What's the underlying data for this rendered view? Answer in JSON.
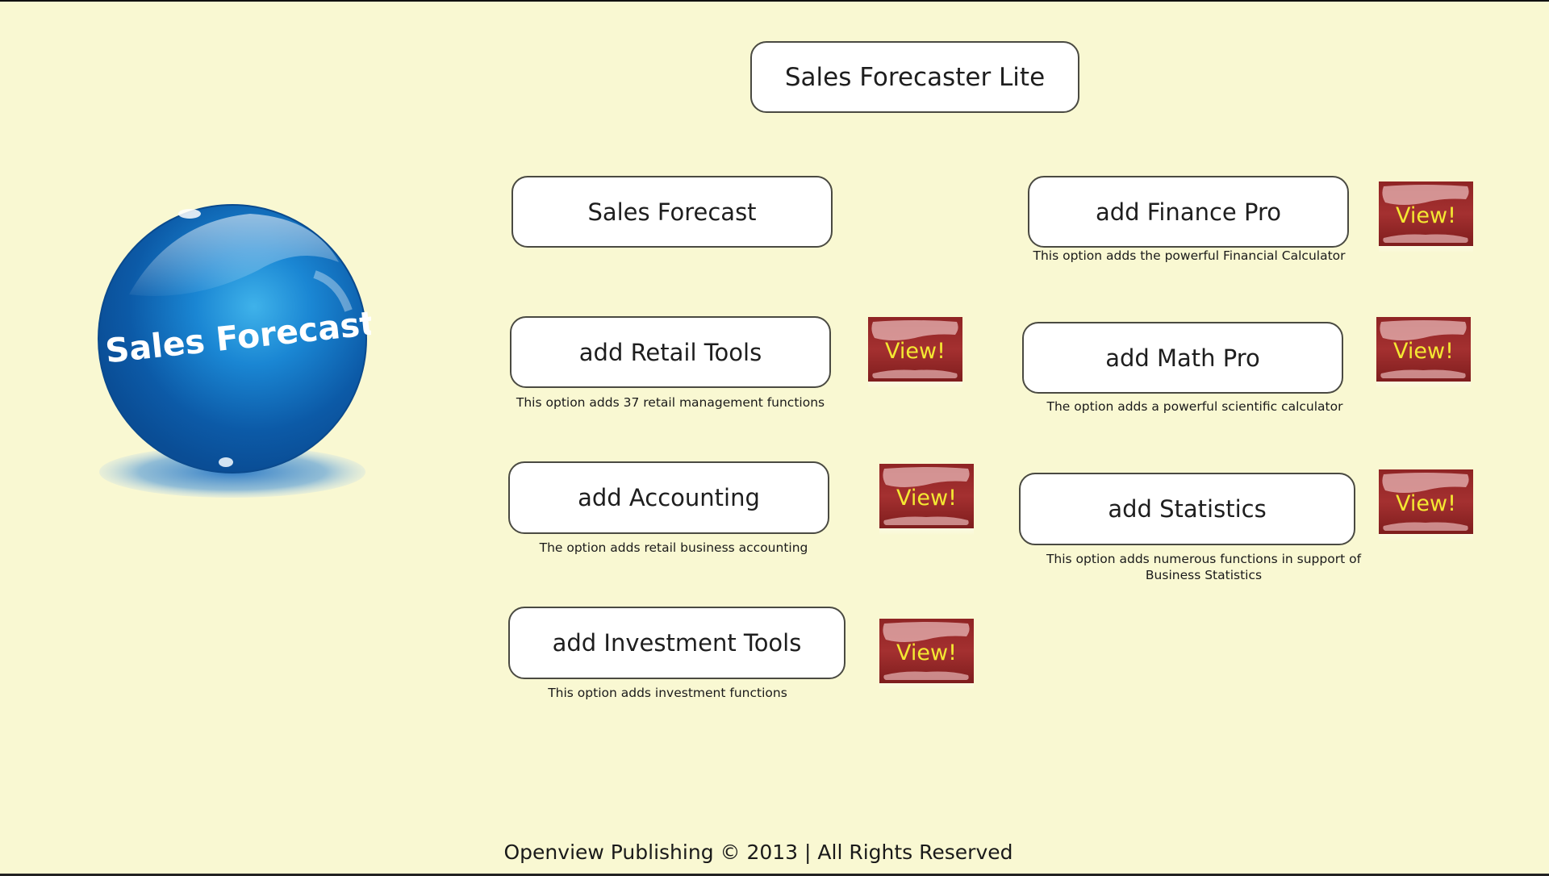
{
  "app": {
    "title": "Sales Forecaster Lite",
    "logo_text": "Sales Forecaster",
    "footer": "Openview Publishing © 2013 | All Rights Reserved"
  },
  "colors": {
    "background": "#f9f8d2",
    "view_button_red": "#9b2c2c",
    "view_button_text": "#f4e832",
    "logo_blue": "#1a6fc0"
  },
  "buttons": {
    "sales_forecast": {
      "label": "Sales Forecast"
    },
    "retail_tools": {
      "label": "add Retail Tools",
      "caption": "This option adds 37 retail management functions",
      "view_label": "View!"
    },
    "accounting": {
      "label": "add Accounting",
      "caption": "The option adds retail business accounting",
      "view_label": "View!"
    },
    "investment_tools": {
      "label": "add Investment Tools",
      "caption": "This option adds investment functions",
      "view_label": "View!"
    },
    "finance_pro": {
      "label": "add Finance Pro",
      "caption": "This option adds the powerful Financial Calculator",
      "view_label": "View!"
    },
    "math_pro": {
      "label": "add Math Pro",
      "caption": "The option adds a powerful scientific calculator",
      "view_label": "View!"
    },
    "statistics": {
      "label": "add Statistics",
      "caption_line1": "This option adds numerous functions in support of",
      "caption_line2": "Business Statistics",
      "view_label": "View!"
    }
  }
}
